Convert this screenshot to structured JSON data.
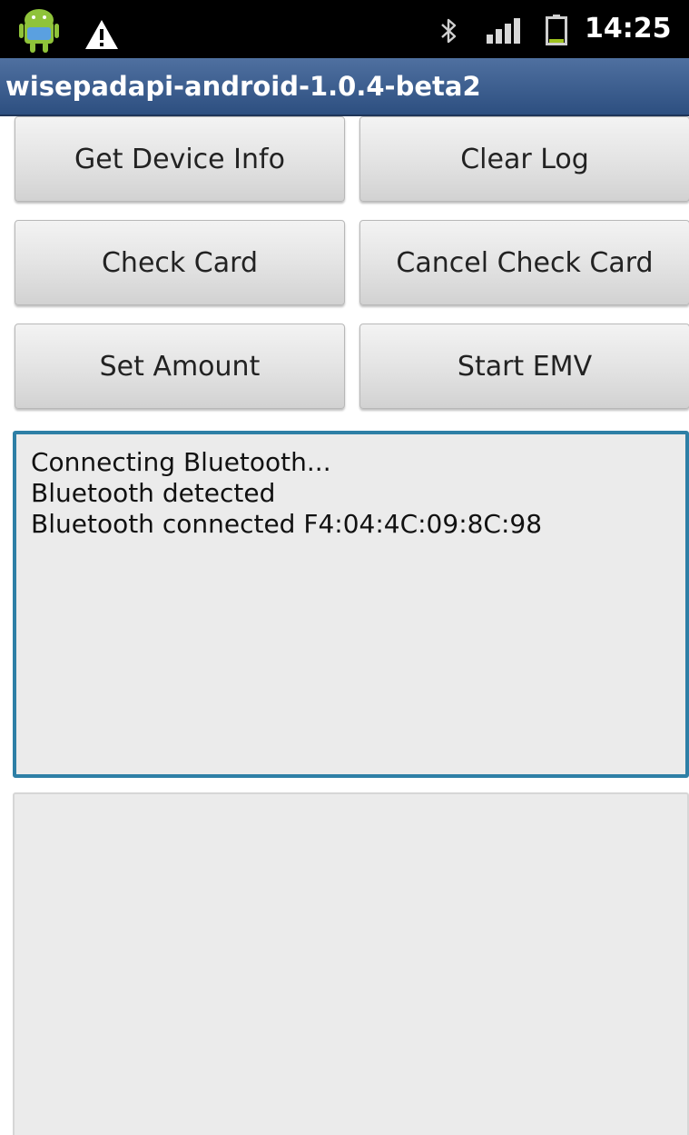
{
  "status_bar": {
    "time": "14:25",
    "left_icons": [
      "android-notification-icon",
      "warning-icon"
    ],
    "right_icons": [
      "bluetooth-icon",
      "signal-icon",
      "battery-icon"
    ],
    "battery_color": "#9ec21f"
  },
  "title_bar": {
    "title": "wisepadapi-android-1.0.4-beta2",
    "color": "#3c5d8f"
  },
  "buttons": {
    "get_device_info": "Get Device Info",
    "clear_log": "Clear Log",
    "check_card": "Check Card",
    "cancel_check_card": "Cancel Check Card",
    "set_amount": "Set Amount",
    "start_emv": "Start EMV"
  },
  "log": {
    "lines": [
      "Connecting Bluetooth...",
      "Bluetooth detected",
      "Bluetooth connected F4:04:4C:09:8C:98"
    ],
    "focus_border_color": "#2e7fa6"
  },
  "output": {
    "text": ""
  }
}
